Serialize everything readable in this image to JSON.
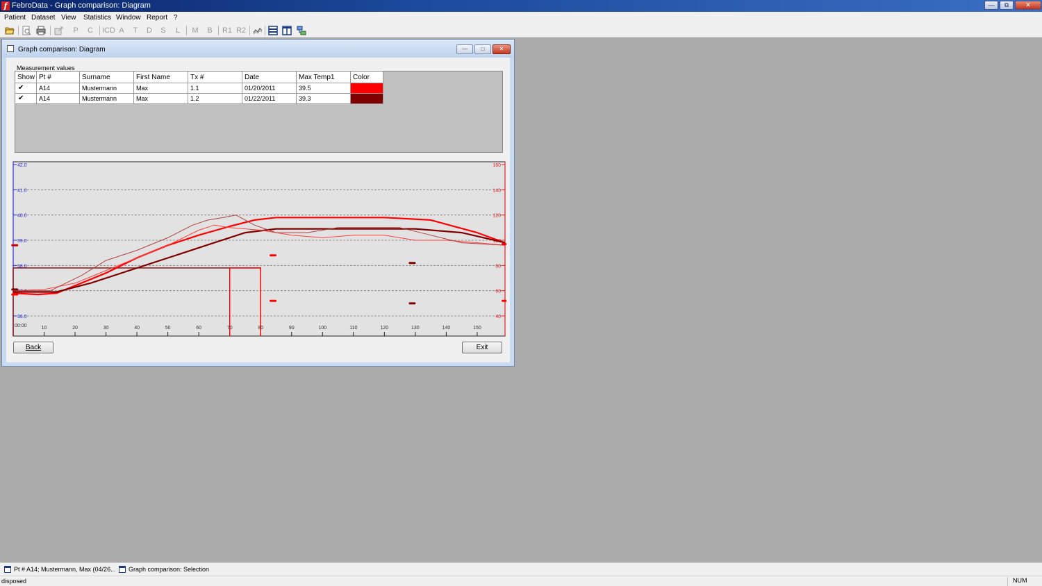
{
  "app": {
    "title": "FebroData - Graph comparison: Diagram",
    "icon": "febrodata-logo"
  },
  "caption_buttons": {
    "minimize": "—",
    "restore": "⧉",
    "close": "✕"
  },
  "menu": [
    "Patient",
    "Dataset",
    "View",
    "Statistics",
    "Window",
    "Report",
    "?"
  ],
  "toolbar": {
    "letters": [
      "P",
      "C",
      "ICD",
      "A",
      "T",
      "D",
      "S",
      "L",
      "M",
      "B",
      "R1",
      "R2"
    ],
    "icons": [
      "open-folder-icon",
      "print-preview-icon",
      "print-icon",
      "export-icon",
      "chart-icon",
      "layout-rows-icon",
      "layout-columns-icon",
      "network-icon"
    ]
  },
  "window": {
    "title": "Graph comparison: Diagram",
    "buttons": {
      "minimize": "—",
      "restore": "□",
      "close": "✕"
    }
  },
  "grid": {
    "label": "Measurement values",
    "columns": [
      "Show",
      "Pt #",
      "Surname",
      "First Name",
      "Tx #",
      "Date",
      "Max Temp1",
      "Color"
    ],
    "rows": [
      {
        "show": true,
        "pt": "A14",
        "surname": "Mustermann",
        "first_name": "Max",
        "tx": "1.1",
        "date": "01/20/2011",
        "max_temp": "39.5",
        "color": "#ff0000"
      },
      {
        "show": true,
        "pt": "A14",
        "surname": "Mustermann",
        "first_name": "Max",
        "tx": "1.2",
        "date": "01/22/2011",
        "max_temp": "39.3",
        "color": "#800000"
      }
    ]
  },
  "chart_data": {
    "type": "line",
    "x_start_label": "00:00",
    "x_ticks": [
      10,
      20,
      30,
      40,
      50,
      60,
      70,
      80,
      90,
      100,
      110,
      120,
      130,
      140,
      150
    ],
    "xlim": [
      0,
      159
    ],
    "y_left": {
      "ticks": [
        "42.0",
        "41.0",
        "40.0",
        "39.0",
        "38.0",
        "37.0",
        "36.0"
      ],
      "ylim": [
        36,
        42
      ],
      "color": "#2a2ad0"
    },
    "y_right": {
      "ticks": [
        "160",
        "140",
        "120",
        "100",
        "80",
        "60",
        "40"
      ],
      "ylim": [
        40,
        160
      ],
      "color": "#e02020"
    },
    "grid": true,
    "series": [
      {
        "color": "#ff0000",
        "width": 2.2,
        "x": [
          0,
          8,
          14,
          20,
          30,
          40,
          50,
          60,
          70,
          78,
          85,
          100,
          120,
          135,
          150,
          159
        ],
        "y": [
          36.9,
          36.85,
          36.9,
          37.2,
          37.7,
          38.3,
          38.8,
          39.2,
          39.55,
          39.8,
          39.9,
          39.9,
          39.9,
          39.8,
          39.3,
          38.9
        ]
      },
      {
        "color": "#800000",
        "width": 2.2,
        "x": [
          0,
          14,
          25,
          40,
          55,
          65,
          75,
          85,
          100,
          115,
          130,
          145,
          159
        ],
        "y": [
          36.95,
          36.95,
          37.3,
          37.9,
          38.5,
          38.9,
          39.3,
          39.45,
          39.45,
          39.45,
          39.45,
          39.3,
          38.9
        ]
      },
      {
        "color": "#ff4040",
        "width": 1,
        "x": [
          0,
          10,
          20,
          30,
          40,
          50,
          60,
          65,
          70,
          80,
          90,
          100,
          110,
          120,
          130,
          140,
          150,
          159
        ],
        "y": [
          37.0,
          37.05,
          37.3,
          37.8,
          38.3,
          38.8,
          39.4,
          39.6,
          39.5,
          39.4,
          39.2,
          39.1,
          39.2,
          39.2,
          39.0,
          39.0,
          38.9,
          38.8
        ]
      },
      {
        "color": "#b04040",
        "width": 1,
        "x": [
          0,
          12,
          22,
          30,
          40,
          50,
          58,
          63,
          68,
          72,
          78,
          85,
          95,
          105,
          115,
          125,
          135,
          145,
          159
        ],
        "y": [
          37.0,
          37.0,
          37.6,
          38.2,
          38.6,
          39.1,
          39.6,
          39.8,
          39.9,
          40.0,
          39.6,
          39.3,
          39.3,
          39.5,
          39.5,
          39.5,
          39.2,
          38.9,
          38.8
        ]
      }
    ],
    "markers": [
      {
        "x": 84,
        "y": 38.4,
        "color": "#ff0000"
      },
      {
        "x": 84,
        "y": 36.6,
        "color": "#ff0000"
      },
      {
        "x": 129,
        "y": 38.1,
        "color": "#800000"
      },
      {
        "x": 129,
        "y": 36.5,
        "color": "#800000"
      },
      {
        "x": 0.5,
        "y": 38.8,
        "color": "#cc0000"
      },
      {
        "x": 0.5,
        "y": 37.05,
        "color": "#800000"
      },
      {
        "x": 0.5,
        "y": 36.85,
        "color": "#ff0000"
      },
      {
        "x": 159,
        "y": 38.85,
        "color": "#ff0000"
      },
      {
        "x": 159,
        "y": 36.6,
        "color": "#ff0000"
      }
    ],
    "boxes": [
      {
        "x0": 0,
        "x1": 80,
        "y_top": 37.9,
        "color": "#800000"
      },
      {
        "x0": 70,
        "x1": 80,
        "y_top": 37.9,
        "color": "#ff0000"
      }
    ]
  },
  "buttons": {
    "back": "Back",
    "exit": "Exit"
  },
  "mdi_windows": [
    "Pt # A14; Mustermann, Max (04/26...",
    "Graph comparison: Selection"
  ],
  "status": {
    "text": "disposed",
    "num": "NUM"
  }
}
